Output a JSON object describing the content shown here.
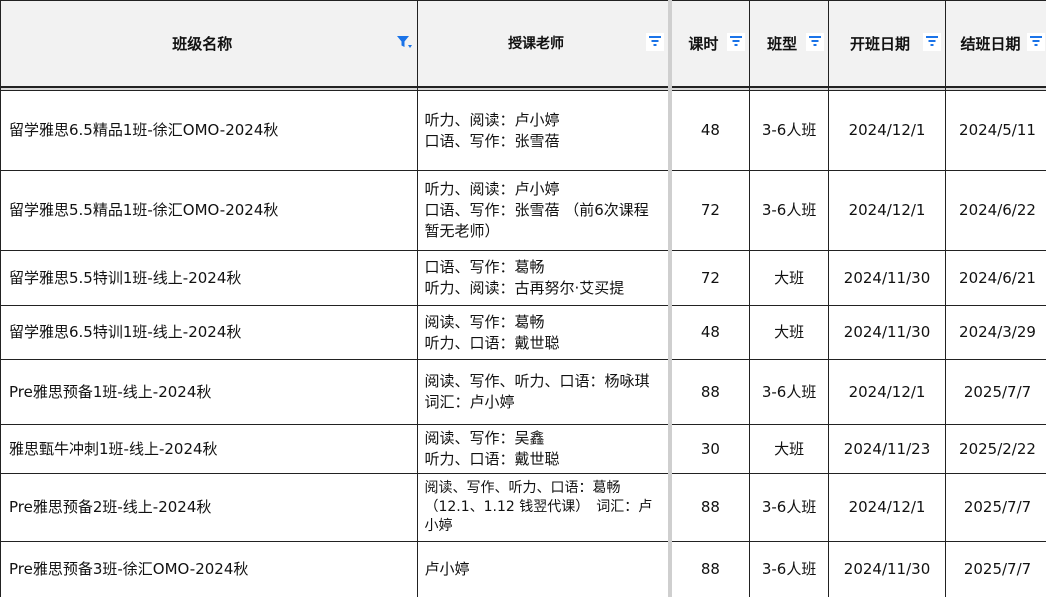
{
  "headers": {
    "class_name": "班级名称",
    "teacher": "授课老师",
    "hours": "课时",
    "type": "班型",
    "start": "开班日期",
    "end": "结班日期"
  },
  "rows": [
    {
      "name": "留学雅思6.5精品1班-徐汇OMO-2024秋",
      "teacher": "听力、阅读：卢小婷\n口语、写作：张雪蓓",
      "hours": "48",
      "type": "3-6人班",
      "start": "2024/12/1",
      "end": "2024/5/11"
    },
    {
      "name": "留学雅思5.5精品1班-徐汇OMO-2024秋",
      "teacher": "听力、阅读：卢小婷\n口语、写作：张雪蓓 （前6次课程暂无老师）",
      "hours": "72",
      "type": "3-6人班",
      "start": "2024/12/1",
      "end": "2024/6/22"
    },
    {
      "name": "留学雅思5.5特训1班-线上-2024秋",
      "teacher": "口语、写作：葛畅\n听力、阅读：古再努尔·艾买提",
      "hours": "72",
      "type": "大班",
      "start": "2024/11/30",
      "end": "2024/6/21"
    },
    {
      "name": "留学雅思6.5特训1班-线上-2024秋",
      "teacher": "阅读、写作：葛畅\n听力、口语：戴世聪",
      "hours": "48",
      "type": "大班",
      "start": "2024/11/30",
      "end": "2024/3/29"
    },
    {
      "name": "Pre雅思预备1班-线上-2024秋",
      "teacher": "阅读、写作、听力、口语：杨咏琪　　　词汇：卢小婷",
      "hours": "88",
      "type": "3-6人班",
      "start": "2024/12/1",
      "end": "2025/7/7"
    },
    {
      "name": "雅思甄牛冲刺1班-线上-2024秋",
      "teacher": "阅读、写作：吴鑫\n听力、口语：戴世聪",
      "hours": "30",
      "type": "大班",
      "start": "2024/11/23",
      "end": "2025/2/22"
    },
    {
      "name": "Pre雅思预备2班-线上-2024秋",
      "teacher": "阅读、写作、听力、口语：葛畅（12.1、1.12 钱翌代课）　词汇：卢小婷",
      "hours": "88",
      "type": "3-6人班",
      "start": "2024/12/1",
      "end": "2025/7/7"
    },
    {
      "name": "Pre雅思预备3班-徐汇OMO-2024秋",
      "teacher": "卢小婷",
      "hours": "88",
      "type": "3-6人班",
      "start": "2024/11/30",
      "end": "2025/7/7"
    }
  ],
  "icons": {
    "filter_active": "filter-active-icon",
    "filter": "filter-icon"
  },
  "colors": {
    "filter_icon": "#1a73e8",
    "header_bg": "#f2f2f2"
  }
}
